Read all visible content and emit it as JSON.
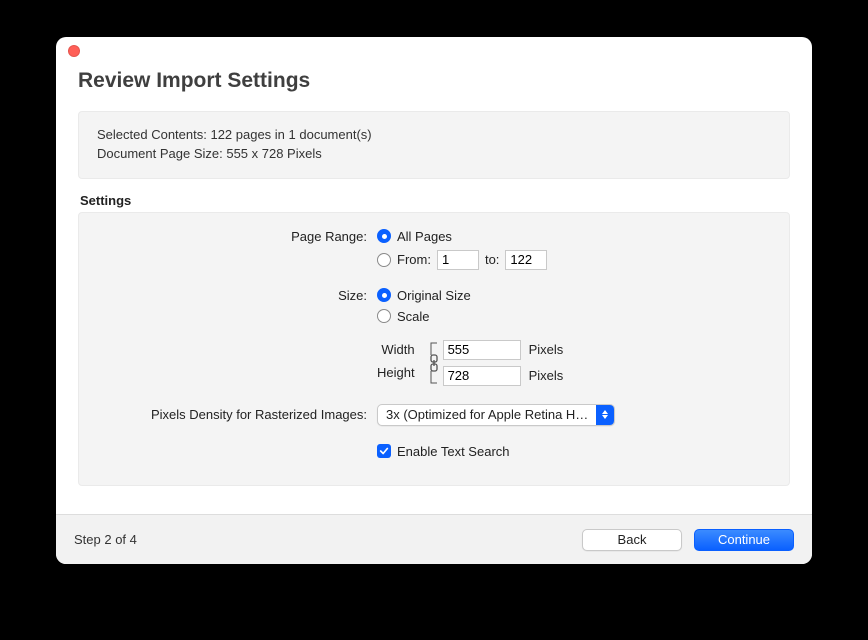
{
  "title": "Review Import Settings",
  "info": {
    "line1": "Selected Contents: 122 pages in 1 document(s)",
    "line2": "Document Page Size: 555 x 728 Pixels"
  },
  "section_label": "Settings",
  "page_range": {
    "label": "Page Range:",
    "all_label": "All Pages",
    "from_label": "From:",
    "to_label": "to:",
    "from_value": "1",
    "to_value": "122"
  },
  "size": {
    "label": "Size:",
    "original_label": "Original Size",
    "scale_label": "Scale",
    "width_label": "Width",
    "height_label": "Height",
    "width_value": "555",
    "height_value": "728",
    "unit": "Pixels"
  },
  "density": {
    "label": "Pixels Density for Rasterized Images:",
    "value": "3x (Optimized for Apple Retina H…"
  },
  "text_search": {
    "label": "Enable Text Search"
  },
  "footer": {
    "step": "Step 2 of 4",
    "back": "Back",
    "continue": "Continue"
  }
}
